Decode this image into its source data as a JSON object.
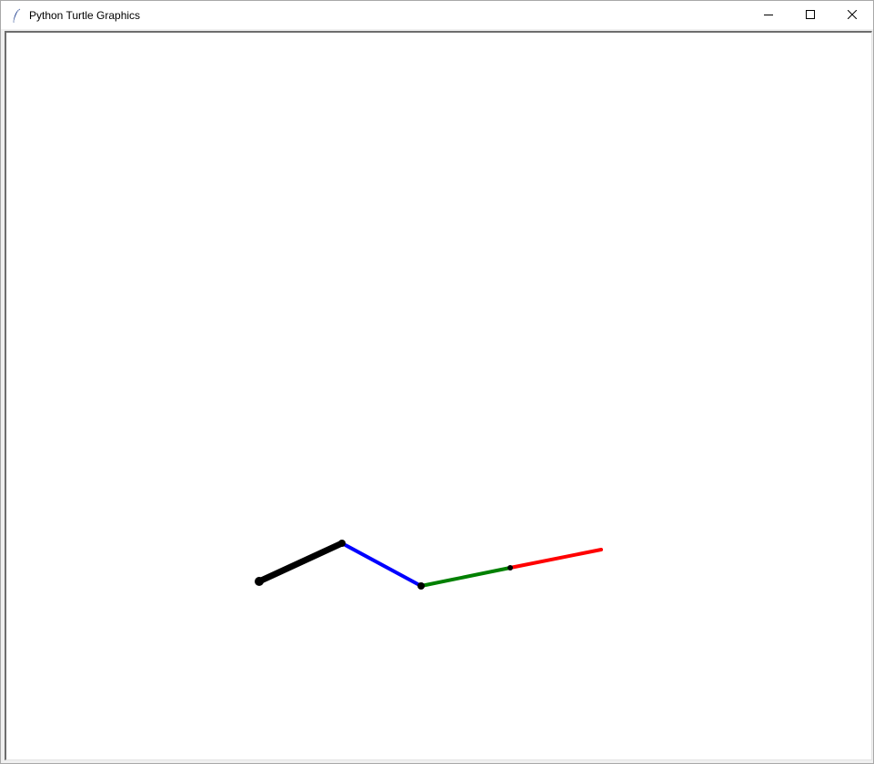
{
  "window": {
    "title": "Python Turtle Graphics",
    "app_icon": "feather-icon",
    "controls": [
      "minimize-icon",
      "maximize-icon",
      "close-icon"
    ]
  },
  "canvas": {
    "background": "#ffffff",
    "segments": [
      {
        "color": "#000000",
        "name": "black-segment"
      },
      {
        "color": "#0000ff",
        "name": "blue-segment"
      },
      {
        "color": "#008000",
        "name": "green-segment"
      },
      {
        "color": "#ff0000",
        "name": "red-segment"
      }
    ],
    "joint_color": "#000000"
  }
}
